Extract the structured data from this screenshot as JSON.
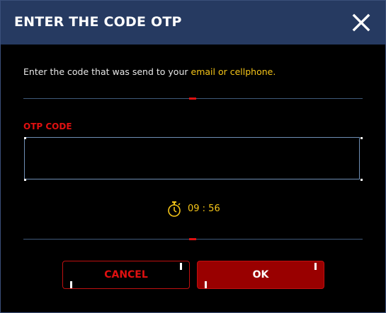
{
  "dialog": {
    "title": "ENTER THE CODE OTP",
    "close_icon": "close-icon"
  },
  "instruction": {
    "prefix": "Enter the code that was send to your ",
    "highlight": "email or cellphone."
  },
  "otp": {
    "label": "OTP CODE",
    "value": "",
    "placeholder": ""
  },
  "timer": {
    "icon": "stopwatch-icon",
    "text": "09 : 56"
  },
  "buttons": {
    "cancel_label": "CANCEL",
    "ok_label": "OK"
  },
  "colors": {
    "header_bg": "#263a61",
    "accent_red": "#e01010",
    "accent_yellow": "#f5c518",
    "ok_bg": "#990000"
  }
}
